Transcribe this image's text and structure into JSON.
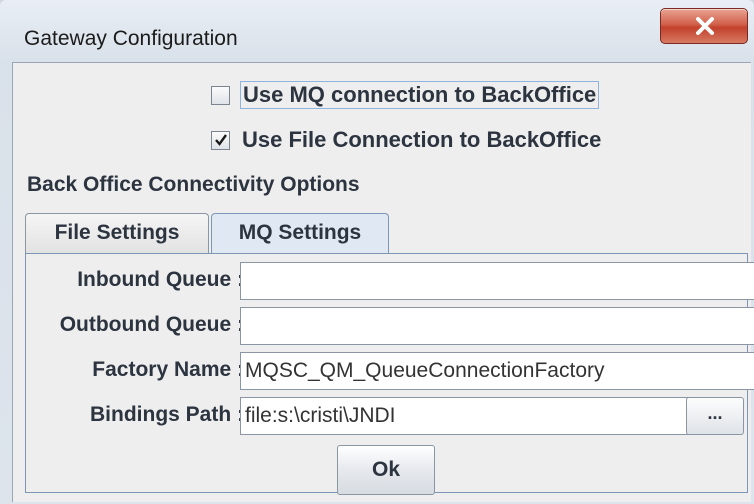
{
  "window": {
    "title": "Gateway Configuration",
    "close_icon": "close-icon"
  },
  "options": {
    "mq_connection": {
      "label": "Use MQ connection to BackOffice",
      "checked": false
    },
    "file_connection": {
      "label": "Use File Connection to BackOffice",
      "checked": true
    }
  },
  "section": {
    "title": "Back Office Connectivity Options"
  },
  "tabs": [
    {
      "label": "File Settings",
      "active": false
    },
    {
      "label": "MQ Settings",
      "active": true
    }
  ],
  "mq_settings": {
    "inbound_queue": {
      "label": "Inbound Queue :",
      "value": ""
    },
    "outbound_queue": {
      "label": "Outbound Queue :",
      "value": ""
    },
    "factory_name": {
      "label": "Factory Name :",
      "value": "MQSC_QM_QueueConnectionFactory"
    },
    "bindings_path": {
      "label": "Bindings Path :",
      "value": "file:s:\\cristi\\JNDI",
      "browse_label": "..."
    }
  },
  "footer": {
    "ok_label": "Ok"
  },
  "colors": {
    "close_button": "#c2412c",
    "active_tab": "#dfe8f3",
    "panel_background": "#eeeeee"
  }
}
